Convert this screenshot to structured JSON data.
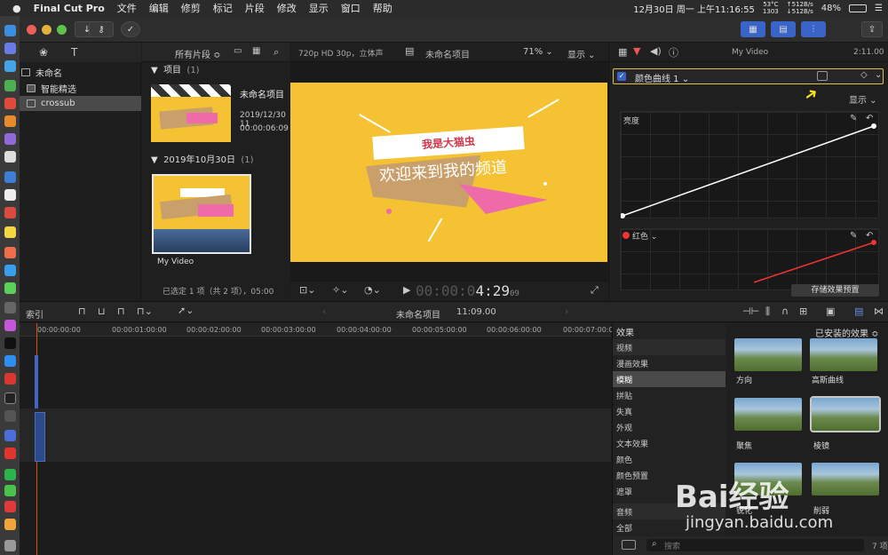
{
  "menubar": {
    "app": "Final Cut Pro",
    "items": [
      "文件",
      "编辑",
      "修剪",
      "标记",
      "片段",
      "修改",
      "显示",
      "窗口",
      "帮助"
    ],
    "status": {
      "datetime": "12月30日 周一 上午11:16:55",
      "temp": "53°C",
      "fan": "1303",
      "net_up": "512B/s",
      "net_down": "512B/s",
      "battery": "48%"
    }
  },
  "toolbar": {
    "timecode": "2:11.00",
    "import_icon": "download-icon",
    "keyword_icon": "key-icon",
    "check_icon": "checkmark-icon"
  },
  "libraries": {
    "items": [
      {
        "label": "未命名"
      },
      {
        "label": "智能精选"
      },
      {
        "label": "crossub"
      }
    ]
  },
  "browser": {
    "filter": "所有片段 ≎",
    "sections": [
      {
        "title": "项目",
        "count": "(1)"
      },
      {
        "title": "2019年10月30日",
        "count": "(1)"
      }
    ],
    "project": {
      "title": "未命名项目",
      "date": "2019/12/30 11",
      "duration": "00:00:06:09"
    },
    "clip_label": "My Video",
    "status": "已选定 1 项（共 2 项），05:00"
  },
  "viewer": {
    "format": "720p HD 30p，立体声",
    "project_name": "未命名项目",
    "zoom": "71%",
    "display": "显示",
    "small_title": "我是大猫虫",
    "main_title": "欢迎来到我的频道",
    "timecode": "00:00:0",
    "timecode_main": "4:29",
    "timecode_frames": "09",
    "bg_color": "#f4c233"
  },
  "inspector": {
    "clip_name": "My Video",
    "effect_name": "颜色曲线 1",
    "display": "显示",
    "luma_label": "亮度",
    "red_label": "红色",
    "save_preset": "存储效果预置"
  },
  "timeline": {
    "index_label": "索引",
    "project": "未命名项目",
    "duration": "11:09.00",
    "ruler": [
      "00:00:00:00",
      "00:00:01:00:00",
      "00:00:02:00:00",
      "00:00:03:00:00",
      "00:00:04:00:00",
      "00:00:05:00:00",
      "00:00:06:00:00",
      "00:00:07:00:00"
    ]
  },
  "effects": {
    "header": "效果",
    "installed": "已安装的效果 ≎",
    "categories": [
      "视频",
      "漫画效果",
      "模糊",
      "拼贴",
      "失真",
      "外观",
      "文本效果",
      "颜色",
      "颜色预置",
      "遮罩",
      "音频",
      "全部"
    ],
    "selected": "模糊",
    "thumbs": [
      {
        "label": "方向"
      },
      {
        "label": "高斯曲线"
      },
      {
        "label": "聚焦"
      },
      {
        "label": "棱镜"
      },
      {
        "label": "锐化"
      },
      {
        "label": "削弱"
      }
    ],
    "search_placeholder": "搜索",
    "count": "7 项"
  },
  "watermark": {
    "brand": "Bai经验",
    "url": "jingyan.baidu.com"
  }
}
